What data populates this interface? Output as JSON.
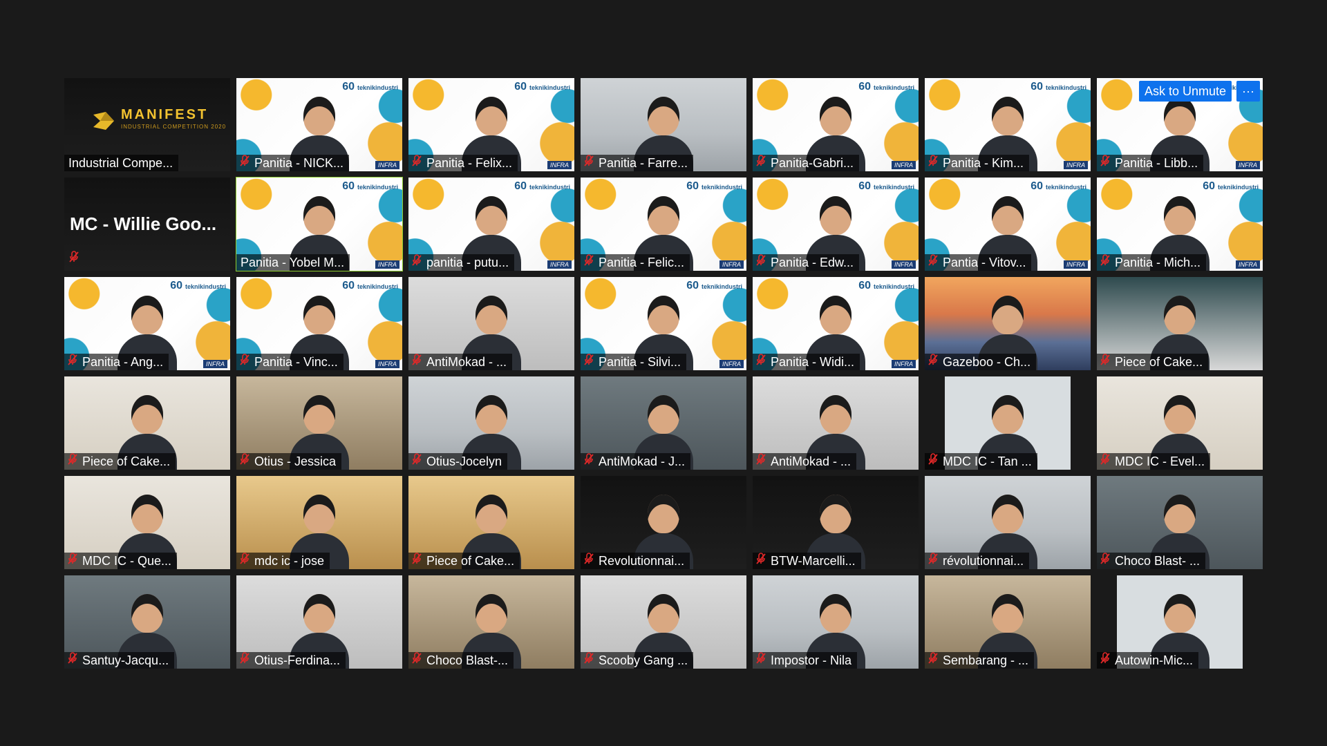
{
  "meeting": {
    "ask_to_unmute_label": "Ask to Unmute",
    "more_options_label": "···",
    "banner_brand": "teknikindustri",
    "banner_sixty": "60",
    "banner_infra": "INFRA",
    "logo_title": "MANIFEST",
    "logo_subtitle": "INDUSTRIAL COMPETITION 2020",
    "mc_name": "MC - Willie Goo..."
  },
  "participants": [
    {
      "name": "Industrial Compe...",
      "muted": false,
      "bg": "dark"
    },
    {
      "name": "Panitia - NICK...",
      "muted": true,
      "bg": "banner"
    },
    {
      "name": "Panitia - Felix...",
      "muted": true,
      "bg": "banner"
    },
    {
      "name": "Panitia - Farre...",
      "muted": true,
      "bg": "room1"
    },
    {
      "name": "Panitia-Gabri...",
      "muted": true,
      "bg": "banner"
    },
    {
      "name": "Panitia - Kim...",
      "muted": true,
      "bg": "banner"
    },
    {
      "name": "Panitia - Libb...",
      "muted": true,
      "bg": "banner"
    },
    {
      "name": "MC - Willie Goo...",
      "muted": true,
      "bg": "dark"
    },
    {
      "name": "Panitia - Yobel M...",
      "muted": false,
      "bg": "banner",
      "active": true
    },
    {
      "name": "panitia - putu...",
      "muted": true,
      "bg": "banner"
    },
    {
      "name": "Panitia - Felic...",
      "muted": true,
      "bg": "banner"
    },
    {
      "name": "Panitia - Edw...",
      "muted": true,
      "bg": "banner"
    },
    {
      "name": "Pantia - Vitov...",
      "muted": true,
      "bg": "banner"
    },
    {
      "name": "Panitia - Mich...",
      "muted": true,
      "bg": "banner"
    },
    {
      "name": "Panitia - Ang...",
      "muted": true,
      "bg": "banner"
    },
    {
      "name": "Panitia - Vinc...",
      "muted": true,
      "bg": "banner"
    },
    {
      "name": "AntiMokad - ...",
      "muted": true,
      "bg": "room5"
    },
    {
      "name": "Panitia - Silvi...",
      "muted": true,
      "bg": "banner"
    },
    {
      "name": "Panitia - Widi...",
      "muted": true,
      "bg": "banner"
    },
    {
      "name": "Gazeboo - Ch...",
      "muted": true,
      "bg": "sunset"
    },
    {
      "name": "Piece of Cake...",
      "muted": true,
      "bg": "teal"
    },
    {
      "name": "Piece of Cake...",
      "muted": true,
      "bg": "room2"
    },
    {
      "name": "Otius - Jessica",
      "muted": true,
      "bg": "room4"
    },
    {
      "name": "Otius-Jocelyn",
      "muted": true,
      "bg": "room1"
    },
    {
      "name": "AntiMokad - J...",
      "muted": true,
      "bg": "room3"
    },
    {
      "name": "AntiMokad - ...",
      "muted": true,
      "bg": "room5"
    },
    {
      "name": "MDC IC - Tan ...",
      "muted": true,
      "bg": "pillar"
    },
    {
      "name": "MDC IC - Evel...",
      "muted": true,
      "bg": "room2"
    },
    {
      "name": "MDC IC - Que...",
      "muted": true,
      "bg": "room2"
    },
    {
      "name": "mdc ic - jose",
      "muted": true,
      "bg": "warm"
    },
    {
      "name": "Piece of Cake...",
      "muted": true,
      "bg": "warm"
    },
    {
      "name": "Revolutionnai...",
      "muted": true,
      "bg": "dark"
    },
    {
      "name": "BTW-Marcelli...",
      "muted": true,
      "bg": "dark"
    },
    {
      "name": "révolutionnai...",
      "muted": true,
      "bg": "room1"
    },
    {
      "name": "Choco Blast- ...",
      "muted": true,
      "bg": "room3"
    },
    {
      "name": "Santuy-Jacqu...",
      "muted": true,
      "bg": "room3"
    },
    {
      "name": "Otius-Ferdina...",
      "muted": true,
      "bg": "room5"
    },
    {
      "name": "Choco Blast-...",
      "muted": true,
      "bg": "room4"
    },
    {
      "name": "Scooby Gang ...",
      "muted": true,
      "bg": "room5"
    },
    {
      "name": "Impostor - Nila",
      "muted": true,
      "bg": "room1"
    },
    {
      "name": "Sembarang - ...",
      "muted": true,
      "bg": "room4"
    },
    {
      "name": "Autowin-Mic...",
      "muted": true,
      "bg": "pillar"
    }
  ]
}
